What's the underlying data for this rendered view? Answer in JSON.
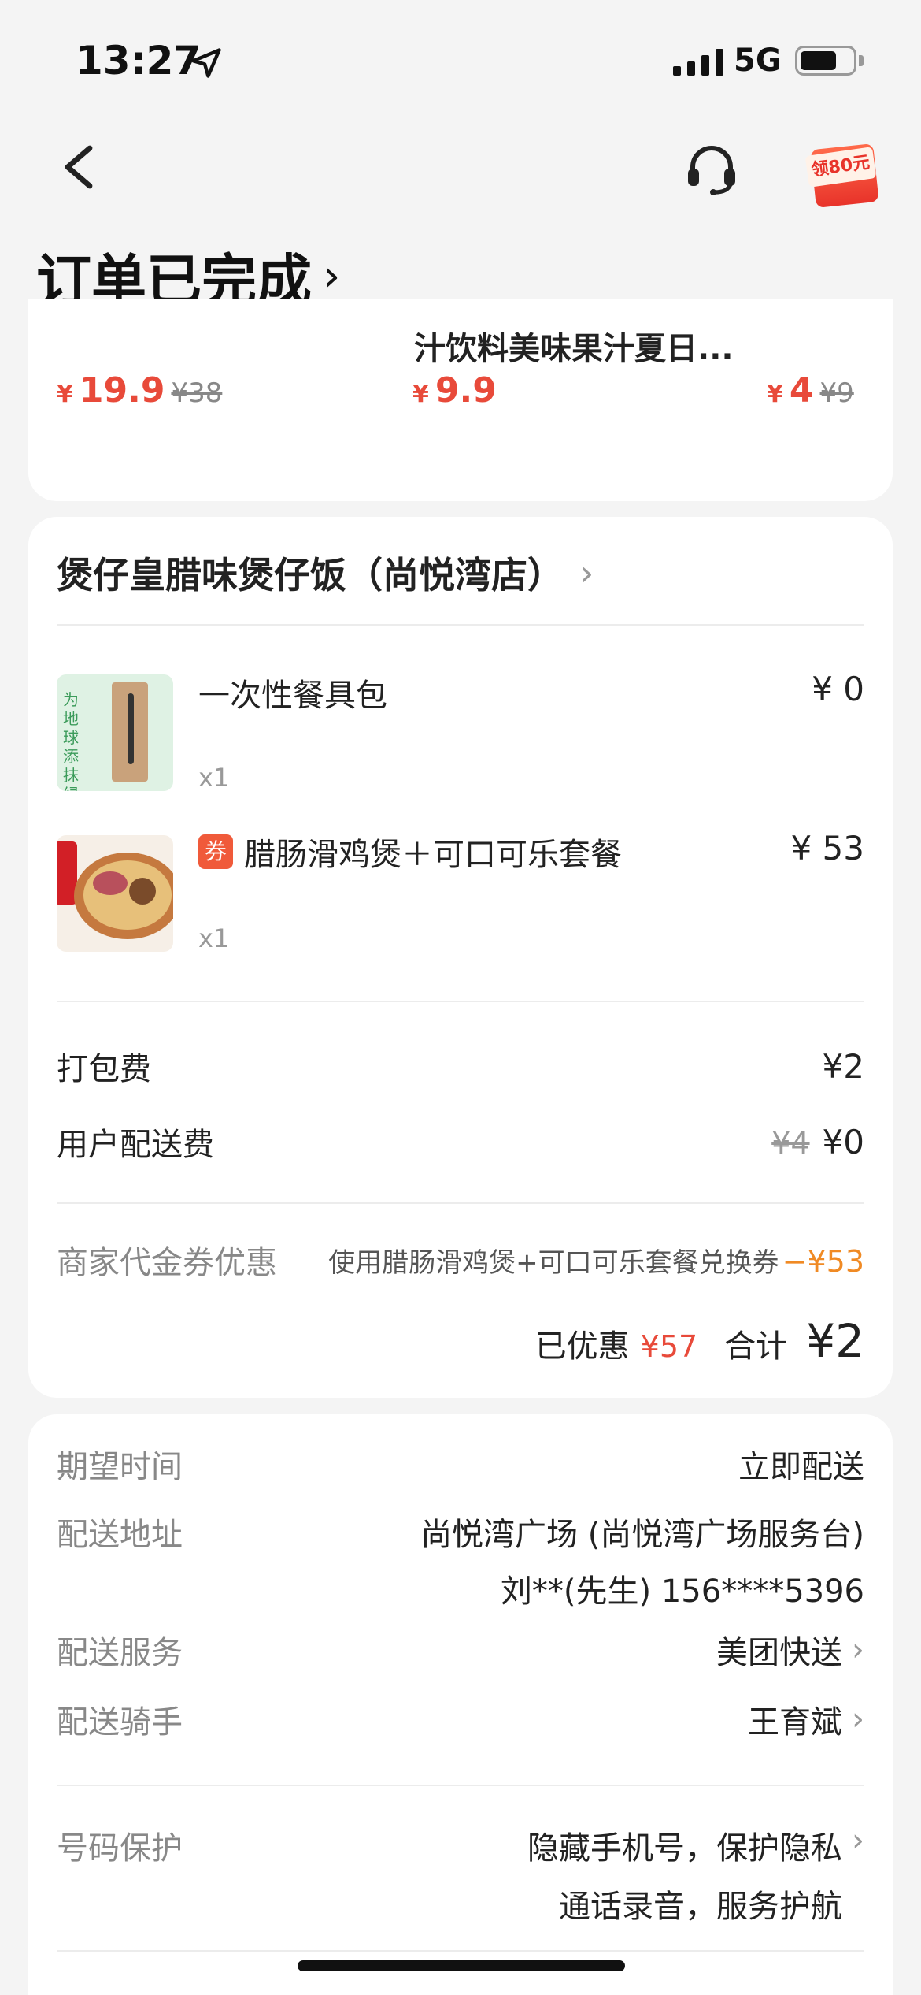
{
  "status_bar": {
    "time": "13:27",
    "network": "5G"
  },
  "header": {
    "title": "订单已完成",
    "title_chevron": "›",
    "promo_label": "领80元"
  },
  "recommend": {
    "item2_title": "汁饮料美味果汁夏日...",
    "items": [
      {
        "yen": "¥",
        "price": "19.9",
        "original": "¥38"
      },
      {
        "yen": "¥",
        "price": "9.9",
        "original": ""
      },
      {
        "yen": "¥",
        "price": "4",
        "original": "¥9"
      }
    ]
  },
  "store": {
    "name": "煲仔皇腊味煲仔饭（尚悦湾店）",
    "chevron": "›",
    "products": [
      {
        "name": "一次性餐具包",
        "qty": "x1",
        "price": "¥ 0",
        "badge": "",
        "thumb_text": "为地球添抹绿"
      },
      {
        "name": "腊肠滑鸡煲＋可口可乐套餐",
        "qty": "x1",
        "price": "¥ 53",
        "badge": "券"
      }
    ],
    "fees": [
      {
        "label": "打包费",
        "value": "¥2",
        "original": ""
      },
      {
        "label": "用户配送费",
        "value": "¥0",
        "original": "¥4"
      }
    ],
    "coupon": {
      "label": "商家代金券优惠",
      "desc": "使用腊肠滑鸡煲+可口可乐套餐兑换券",
      "amount": "−¥53"
    },
    "summary": {
      "discount_label": "已优惠",
      "discount_value": "¥57",
      "total_label": "合计",
      "total_value": "¥2"
    }
  },
  "delivery": {
    "expected_label": "期望时间",
    "expected_value": "立即配送",
    "address_label": "配送地址",
    "address_line1": "尚悦湾广场 (尚悦湾广场服务台)",
    "address_line2": "刘**(先生) 156****5396",
    "service_label": "配送服务",
    "service_value": "美团快送",
    "rider_label": "配送骑手",
    "rider_value": "王育斌",
    "privacy_label": "号码保护",
    "privacy_line1": "隐藏手机号，保护隐私",
    "privacy_line2": "通话录音，服务护航"
  },
  "colors": {
    "accent_red": "#e84a3a",
    "discount_orange": "#f08a24"
  }
}
